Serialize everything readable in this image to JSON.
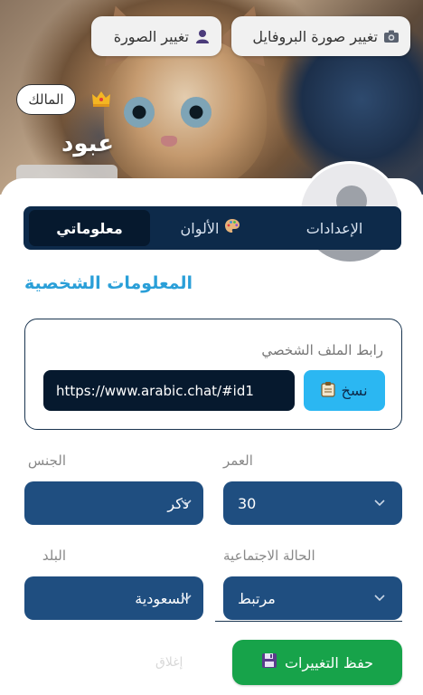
{
  "header": {
    "change_cover_label": "تغيير صورة البروفايل",
    "change_photo_label": "تغيير الصورة",
    "owner_badge": "المالك",
    "user_name": "عبود"
  },
  "tabs": [
    {
      "label": "معلوماتي"
    },
    {
      "label": "الألوان"
    },
    {
      "label": "الإعدادات"
    }
  ],
  "section": {
    "title": "المعلومات الشخصية"
  },
  "profile_link": {
    "label": "رابط الملف الشخصي",
    "value": "https://www.arabic.chat/#id1",
    "copy_label": "نسخ"
  },
  "fields": {
    "age": {
      "label": "العمر",
      "value": "30"
    },
    "gender": {
      "label": "الجنس",
      "value": "ذكر"
    },
    "marital": {
      "label": "الحالة الاجتماعية",
      "value": "مرتبط"
    },
    "country": {
      "label": "البلد",
      "value": "السعودية"
    }
  },
  "actions": {
    "save_label": "حفظ التغييرات",
    "close_label": "إغلاق"
  },
  "colors": {
    "accent": "#2a9fd8",
    "tabbar": "#0d2a4a",
    "select_bg": "#1f4e80",
    "save_green": "#17a34a",
    "copy_blue": "#2bb7f2"
  },
  "icons": [
    "camera-icon",
    "user-icon",
    "crown-icon",
    "palette-icon",
    "clipboard-icon",
    "chevron-down-icon",
    "floppy-disk-icon"
  ]
}
